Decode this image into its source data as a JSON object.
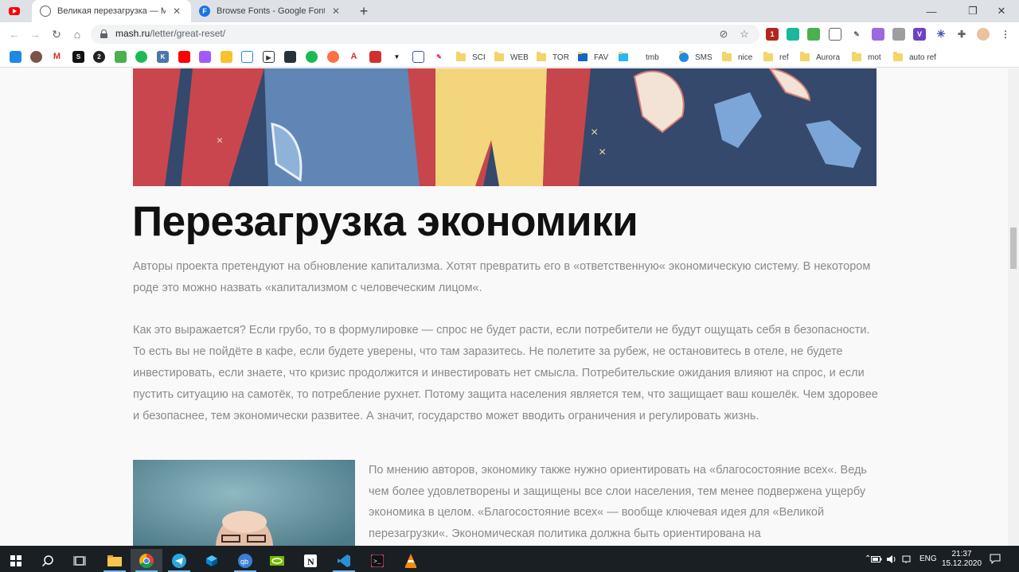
{
  "browser": {
    "tabs": [
      {
        "title": "Великая перезагрузка — Mash",
        "favicon": "mash-icon",
        "active": true
      },
      {
        "title": "Browse Fonts - Google Fonts",
        "favicon": "google-fonts-icon",
        "active": false
      }
    ],
    "new_tab": "+",
    "window": {
      "minimize": "—",
      "maximize": "❐",
      "close": "✕"
    },
    "nav": {
      "back": "←",
      "forward": "→",
      "reload": "↻",
      "home": "⌂"
    },
    "address": {
      "host": "mash.ru",
      "path": "/letter/great-reset/"
    },
    "omnibox_icons": {
      "eye": "⊘",
      "star": "☆"
    },
    "extension_badge": "1"
  },
  "bookmarks": {
    "folders": [
      "SCI",
      "WEB",
      "TOR",
      "FAV",
      "tmb",
      "SMS",
      "nice",
      "ref",
      "Aurora",
      "mot",
      "auto ref"
    ]
  },
  "article": {
    "headline": "Перезагрузка экономики",
    "paragraph_1": "Авторы проекта претендуют на обновление капитализма. Хотят превратить его в «ответственную« экономическую систему. В некотором роде это можно назвать «капитализмом с человеческим лицом«.",
    "paragraph_2": "Как это выражается? Если грубо, то в формулировке — спрос не будет расти, если потребители не будут ощущать себя в безопасности. То есть вы не пойдёте в кафе, если будете уверены, что там заразитесь. Не полетите за рубеж, не остановитесь в отеле, не будете инвестировать, если знаете, что кризис продолжится и инвестировать нет смысла. Потребительские ожидания влияют на спрос, и если пустить ситуацию на самотёк, то потребление рухнет. Потому защита населения является тем, что защищает ваш кошелёк. Чем здоровее и безопаснее, тем экономически развитее. А значит, государство может вводить ограничения и регулировать жизнь.",
    "paragraph_3": "По мнению авторов, экономику также нужно ориентировать на «благосостояние всех«. Ведь чем более удовлетворены и защищены все слои населения, тем менее подвержена ущербу экономика в целом. «Благосостояние всех« — вообще ключевая идея для «Великой перезагрузки«. Экономическая политика должна быть ориентирована на"
  },
  "taskbar": {
    "language": "ENG",
    "time": "21:37",
    "date": "15.12.2020"
  }
}
